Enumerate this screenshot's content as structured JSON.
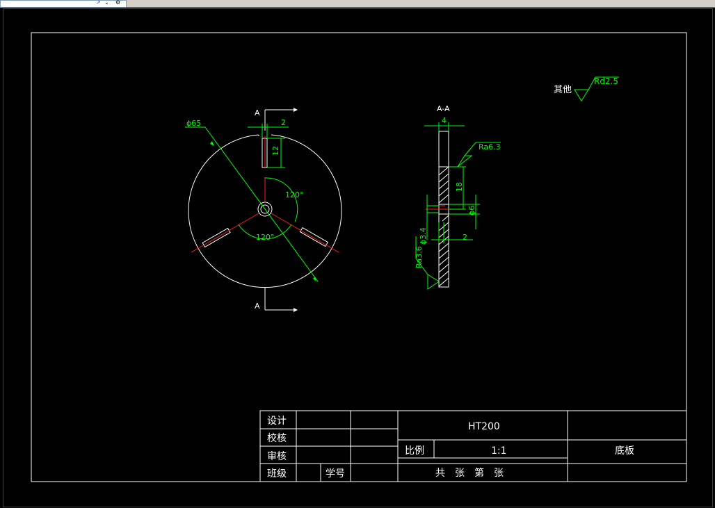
{
  "drawing": {
    "section_label": "A",
    "section_title": "A-A",
    "dims": {
      "diameter": "ϕ65",
      "slot_width": "2",
      "slot_length": "12",
      "angle_top": "120°",
      "angle_bottom": "120°",
      "thickness": "4",
      "height_18": "18",
      "hole_d6": "ϕ6",
      "hole_d34": "ϕ3.4",
      "step_2": "2"
    },
    "roughness": {
      "ra63": "Ra6.3",
      "ra36": "Ra3.6",
      "other_label": "其他",
      "other_value": "Rd2.5"
    }
  },
  "title_block": {
    "design": "设计",
    "check": "校核",
    "review": "审核",
    "class": "班级",
    "student_no": "学号",
    "material": "HT200",
    "scale_label": "比例",
    "scale_value": "1:1",
    "part_name": "底板",
    "sheets": "共　张　第　张"
  },
  "colors": {
    "background": "#000000",
    "outline": "#ffffff",
    "dimension": "#00ff00",
    "centerline": "#ff2020"
  }
}
